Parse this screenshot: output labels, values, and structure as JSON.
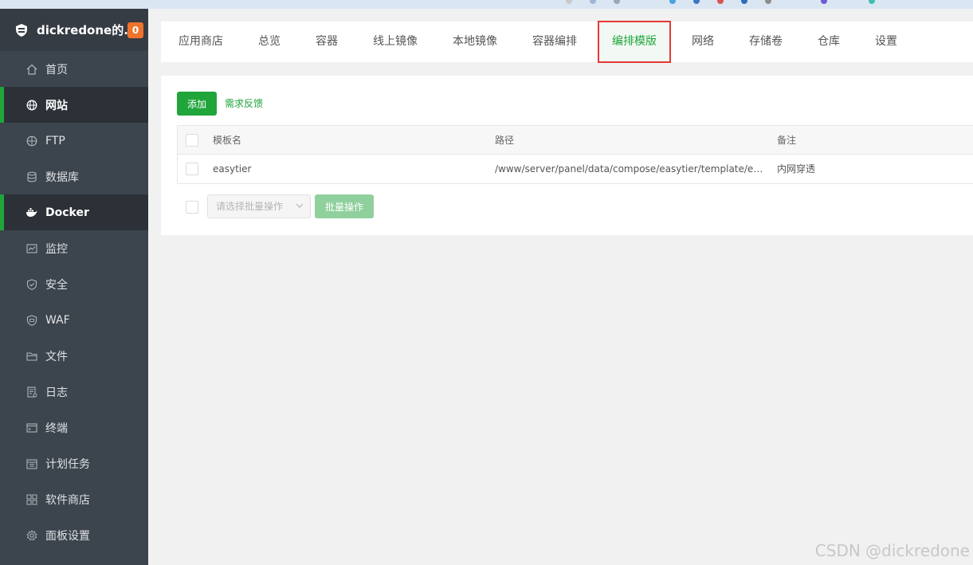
{
  "sidebar": {
    "brand_name": "dickredone的...",
    "badge_count": "0",
    "items": [
      {
        "label": "首页",
        "icon": "home-icon"
      },
      {
        "label": "网站",
        "icon": "globe-icon",
        "active": true
      },
      {
        "label": "FTP",
        "icon": "ftp-icon"
      },
      {
        "label": "数据库",
        "icon": "database-icon"
      },
      {
        "label": "Docker",
        "icon": "docker-icon",
        "active": true
      },
      {
        "label": "监控",
        "icon": "monitor-icon"
      },
      {
        "label": "安全",
        "icon": "shield-icon"
      },
      {
        "label": "WAF",
        "icon": "waf-icon"
      },
      {
        "label": "文件",
        "icon": "folder-icon"
      },
      {
        "label": "日志",
        "icon": "log-icon"
      },
      {
        "label": "终端",
        "icon": "terminal-icon"
      },
      {
        "label": "计划任务",
        "icon": "calendar-icon"
      },
      {
        "label": "软件商店",
        "icon": "apps-icon"
      },
      {
        "label": "面板设置",
        "icon": "gear-icon"
      }
    ]
  },
  "tabs": [
    {
      "label": "应用商店"
    },
    {
      "label": "总览"
    },
    {
      "label": "容器"
    },
    {
      "label": "线上镜像"
    },
    {
      "label": "本地镜像"
    },
    {
      "label": "容器编排"
    },
    {
      "label": "编排模版",
      "active": true
    },
    {
      "label": "网络"
    },
    {
      "label": "存储卷"
    },
    {
      "label": "仓库"
    },
    {
      "label": "设置"
    }
  ],
  "toolbar": {
    "add_label": "添加",
    "feedback_label": "需求反馈"
  },
  "table": {
    "columns": [
      "模板名",
      "路径",
      "备注"
    ],
    "rows": [
      {
        "name": "easytier",
        "path": "/www/server/panel/data/compose/easytier/template/ea...",
        "note": "内网穿透"
      }
    ]
  },
  "batch": {
    "select_placeholder": "请选择批量操作",
    "button_label": "批量操作"
  },
  "watermark": "CSDN @dickredone",
  "colors": {
    "accent": "#20a53a",
    "sidebar_bg": "#3c444d",
    "highlight_border": "#e53935",
    "badge": "#f0732b"
  }
}
